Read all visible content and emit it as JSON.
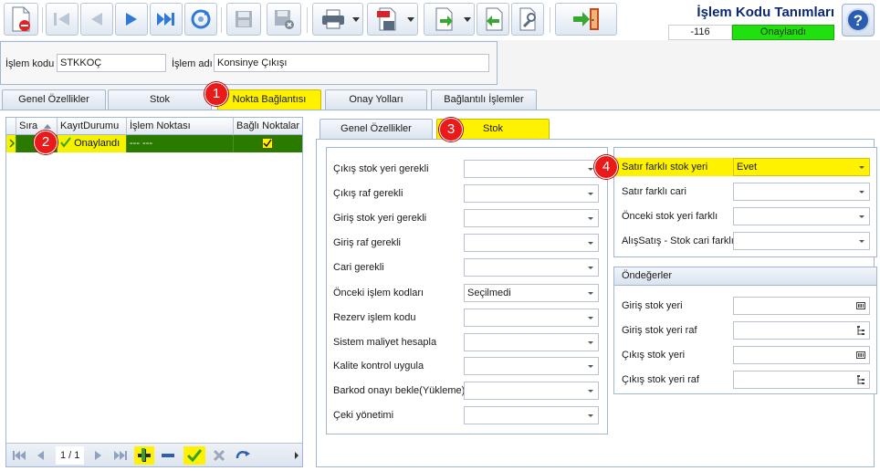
{
  "header": {
    "title": "İşlem Kodu Tanımları",
    "code_value": "-116",
    "status": "Onaylandı"
  },
  "toolbar": {
    "buttons": [
      "new-delete-icon",
      "first-record-icon",
      "previous-record-icon",
      "next-record-icon",
      "last-record-icon",
      "refresh-icon",
      "save-icon",
      "save-cancel-icon",
      "print-icon",
      "pdf-export-icon",
      "export-icon",
      "import-icon",
      "tools-icon",
      "exit-icon",
      "help-icon"
    ]
  },
  "fields": {
    "code_label": "İşlem kodu",
    "code_value": "STKKOÇ",
    "name_label": "İşlem adı",
    "name_value": "Konsinye Çıkışı"
  },
  "tabs": [
    "Genel Özellikler",
    "Stok",
    "Nokta Bağlantısı",
    "Onay Yolları",
    "Bağlantılı İşlemler"
  ],
  "active_tab": "Nokta Bağlantısı",
  "badges": [
    "1",
    "2",
    "3",
    "4"
  ],
  "grid": {
    "columns": [
      "Sıra",
      "KayıtDurumu",
      "İşlem Noktası",
      "Bağlı Noktalar"
    ],
    "rows": [
      {
        "sira": "",
        "kayit_durumu": "Onaylandı",
        "islem_noktasi": "--- ---",
        "bagli_noktalar": "checked"
      }
    ],
    "pager": "1 / 1"
  },
  "inner_tabs": [
    "Genel Özellikler",
    "Stok"
  ],
  "inner_active": "Stok",
  "stok_left": [
    {
      "label": "Çıkış stok yeri gerekli",
      "value": ""
    },
    {
      "label": "Çıkış raf gerekli",
      "value": ""
    },
    {
      "label": "Giriş stok yeri gerekli",
      "value": ""
    },
    {
      "label": "Giriş raf gerekli",
      "value": ""
    },
    {
      "label": "Cari gerekli",
      "value": ""
    },
    {
      "label": "Önceki işlem kodları",
      "value": "Seçilmedi"
    },
    {
      "label": "Rezerv işlem kodu",
      "value": ""
    },
    {
      "label": "Sistem maliyet hesapla",
      "value": ""
    },
    {
      "label": "Kalite kontrol uygula",
      "value": ""
    },
    {
      "label": "Barkod onayı bekle(Yükleme)",
      "value": ""
    },
    {
      "label": "Çeki yönetimi",
      "value": ""
    }
  ],
  "stok_right": [
    {
      "label": "Satır farklı stok yeri",
      "value": "Evet"
    },
    {
      "label": "Satır farklı cari",
      "value": ""
    },
    {
      "label": "Önceki stok yeri farklı",
      "value": ""
    },
    {
      "label": "AlışSatış - Stok cari farklı",
      "value": ""
    }
  ],
  "defaults": {
    "title": "Öndeğerler",
    "items": [
      {
        "label": "Giriş stok yeri",
        "value": "",
        "icon": "list-picker-icon"
      },
      {
        "label": "Giriş stok yeri raf",
        "value": "",
        "icon": "tree-picker-icon"
      },
      {
        "label": "Çıkış stok yeri",
        "value": "",
        "icon": "list-picker-icon"
      },
      {
        "label": "Çıkış stok yeri raf",
        "value": "",
        "icon": "tree-picker-icon"
      }
    ]
  },
  "colors": {
    "highlight": "#fff200",
    "approved": "#22e010",
    "row_selected": "#2b7a00",
    "badge": "#e81a1a"
  }
}
